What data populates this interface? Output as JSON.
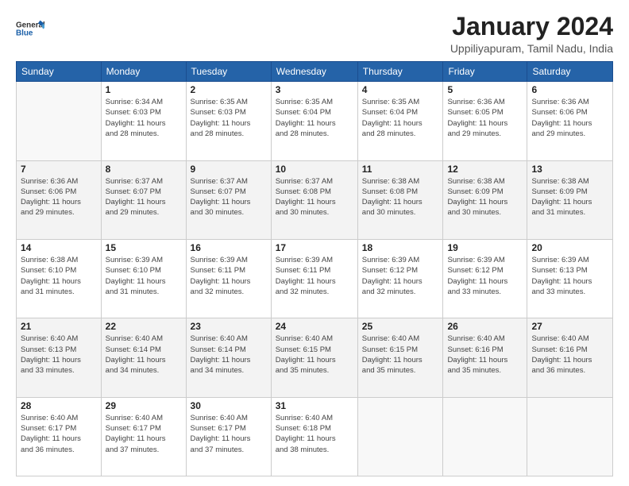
{
  "logo": {
    "line1": "General",
    "line2": "Blue"
  },
  "title": "January 2024",
  "subtitle": "Uppiliyapuram, Tamil Nadu, India",
  "days_of_week": [
    "Sunday",
    "Monday",
    "Tuesday",
    "Wednesday",
    "Thursday",
    "Friday",
    "Saturday"
  ],
  "weeks": [
    [
      {
        "day": "",
        "empty": true
      },
      {
        "day": "1",
        "sunrise": "6:34 AM",
        "sunset": "6:03 PM",
        "daylight": "11 hours and 28 minutes."
      },
      {
        "day": "2",
        "sunrise": "6:35 AM",
        "sunset": "6:03 PM",
        "daylight": "11 hours and 28 minutes."
      },
      {
        "day": "3",
        "sunrise": "6:35 AM",
        "sunset": "6:04 PM",
        "daylight": "11 hours and 28 minutes."
      },
      {
        "day": "4",
        "sunrise": "6:35 AM",
        "sunset": "6:04 PM",
        "daylight": "11 hours and 28 minutes."
      },
      {
        "day": "5",
        "sunrise": "6:36 AM",
        "sunset": "6:05 PM",
        "daylight": "11 hours and 29 minutes."
      },
      {
        "day": "6",
        "sunrise": "6:36 AM",
        "sunset": "6:06 PM",
        "daylight": "11 hours and 29 minutes."
      }
    ],
    [
      {
        "day": "7",
        "sunrise": "6:36 AM",
        "sunset": "6:06 PM",
        "daylight": "11 hours and 29 minutes."
      },
      {
        "day": "8",
        "sunrise": "6:37 AM",
        "sunset": "6:07 PM",
        "daylight": "11 hours and 29 minutes."
      },
      {
        "day": "9",
        "sunrise": "6:37 AM",
        "sunset": "6:07 PM",
        "daylight": "11 hours and 30 minutes."
      },
      {
        "day": "10",
        "sunrise": "6:37 AM",
        "sunset": "6:08 PM",
        "daylight": "11 hours and 30 minutes."
      },
      {
        "day": "11",
        "sunrise": "6:38 AM",
        "sunset": "6:08 PM",
        "daylight": "11 hours and 30 minutes."
      },
      {
        "day": "12",
        "sunrise": "6:38 AM",
        "sunset": "6:09 PM",
        "daylight": "11 hours and 30 minutes."
      },
      {
        "day": "13",
        "sunrise": "6:38 AM",
        "sunset": "6:09 PM",
        "daylight": "11 hours and 31 minutes."
      }
    ],
    [
      {
        "day": "14",
        "sunrise": "6:38 AM",
        "sunset": "6:10 PM",
        "daylight": "11 hours and 31 minutes."
      },
      {
        "day": "15",
        "sunrise": "6:39 AM",
        "sunset": "6:10 PM",
        "daylight": "11 hours and 31 minutes."
      },
      {
        "day": "16",
        "sunrise": "6:39 AM",
        "sunset": "6:11 PM",
        "daylight": "11 hours and 32 minutes."
      },
      {
        "day": "17",
        "sunrise": "6:39 AM",
        "sunset": "6:11 PM",
        "daylight": "11 hours and 32 minutes."
      },
      {
        "day": "18",
        "sunrise": "6:39 AM",
        "sunset": "6:12 PM",
        "daylight": "11 hours and 32 minutes."
      },
      {
        "day": "19",
        "sunrise": "6:39 AM",
        "sunset": "6:12 PM",
        "daylight": "11 hours and 33 minutes."
      },
      {
        "day": "20",
        "sunrise": "6:39 AM",
        "sunset": "6:13 PM",
        "daylight": "11 hours and 33 minutes."
      }
    ],
    [
      {
        "day": "21",
        "sunrise": "6:40 AM",
        "sunset": "6:13 PM",
        "daylight": "11 hours and 33 minutes."
      },
      {
        "day": "22",
        "sunrise": "6:40 AM",
        "sunset": "6:14 PM",
        "daylight": "11 hours and 34 minutes."
      },
      {
        "day": "23",
        "sunrise": "6:40 AM",
        "sunset": "6:14 PM",
        "daylight": "11 hours and 34 minutes."
      },
      {
        "day": "24",
        "sunrise": "6:40 AM",
        "sunset": "6:15 PM",
        "daylight": "11 hours and 35 minutes."
      },
      {
        "day": "25",
        "sunrise": "6:40 AM",
        "sunset": "6:15 PM",
        "daylight": "11 hours and 35 minutes."
      },
      {
        "day": "26",
        "sunrise": "6:40 AM",
        "sunset": "6:16 PM",
        "daylight": "11 hours and 35 minutes."
      },
      {
        "day": "27",
        "sunrise": "6:40 AM",
        "sunset": "6:16 PM",
        "daylight": "11 hours and 36 minutes."
      }
    ],
    [
      {
        "day": "28",
        "sunrise": "6:40 AM",
        "sunset": "6:17 PM",
        "daylight": "11 hours and 36 minutes."
      },
      {
        "day": "29",
        "sunrise": "6:40 AM",
        "sunset": "6:17 PM",
        "daylight": "11 hours and 37 minutes."
      },
      {
        "day": "30",
        "sunrise": "6:40 AM",
        "sunset": "6:17 PM",
        "daylight": "11 hours and 37 minutes."
      },
      {
        "day": "31",
        "sunrise": "6:40 AM",
        "sunset": "6:18 PM",
        "daylight": "11 hours and 38 minutes."
      },
      {
        "day": "",
        "empty": true
      },
      {
        "day": "",
        "empty": true
      },
      {
        "day": "",
        "empty": true
      }
    ]
  ]
}
